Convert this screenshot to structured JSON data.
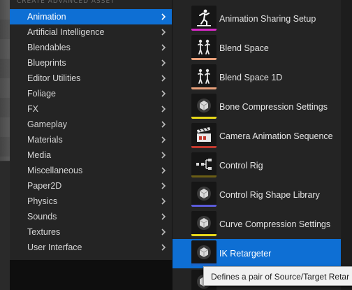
{
  "menu": {
    "header": "CREATE ADVANCED ASSET",
    "items": [
      {
        "label": "Animation",
        "selected": true
      },
      {
        "label": "Artificial Intelligence"
      },
      {
        "label": "Blendables"
      },
      {
        "label": "Blueprints"
      },
      {
        "label": "Editor Utilities"
      },
      {
        "label": "Foliage"
      },
      {
        "label": "FX"
      },
      {
        "label": "Gameplay"
      },
      {
        "label": "Materials"
      },
      {
        "label": "Media"
      },
      {
        "label": "Miscellaneous"
      },
      {
        "label": "Paper2D"
      },
      {
        "label": "Physics"
      },
      {
        "label": "Sounds"
      },
      {
        "label": "Textures"
      },
      {
        "label": "User Interface"
      }
    ]
  },
  "assets": {
    "items": [
      {
        "label": "Animation Sharing Setup",
        "icon": "animation-sharing-icon",
        "stripe": "#d629c6"
      },
      {
        "label": "Blend Space",
        "icon": "blend-space-icon",
        "stripe": "#e8a07a"
      },
      {
        "label": "Blend Space 1D",
        "icon": "blend-space-1d-icon",
        "stripe": "#e8a07a"
      },
      {
        "label": "Bone Compression Settings",
        "icon": "bone-compression-icon",
        "stripe": "#e6d719"
      },
      {
        "label": "Camera Animation Sequence",
        "icon": "camera-animation-sequence-icon",
        "stripe": "#c1392e"
      },
      {
        "label": "Control Rig",
        "icon": "control-rig-icon",
        "stripe": "#6b5e15"
      },
      {
        "label": "Control Rig Shape Library",
        "icon": "control-rig-shape-library-icon",
        "stripe": "#5a5ad8"
      },
      {
        "label": "Curve Compression Settings",
        "icon": "curve-compression-icon",
        "stripe": "#e6d719"
      },
      {
        "label": "IK Retargeter",
        "icon": "ik-retargeter-icon",
        "stripe": "#1d64c8",
        "selected": true
      },
      {
        "label": "",
        "icon": "partial-asset-icon",
        "stripe": "#ffffff"
      }
    ]
  },
  "tooltip": {
    "text": "Defines a pair of Source/Target Retar"
  },
  "colors": {
    "selection": "#0e6fd4",
    "menu_bg": "#242424",
    "text": "#d6d6d6"
  }
}
